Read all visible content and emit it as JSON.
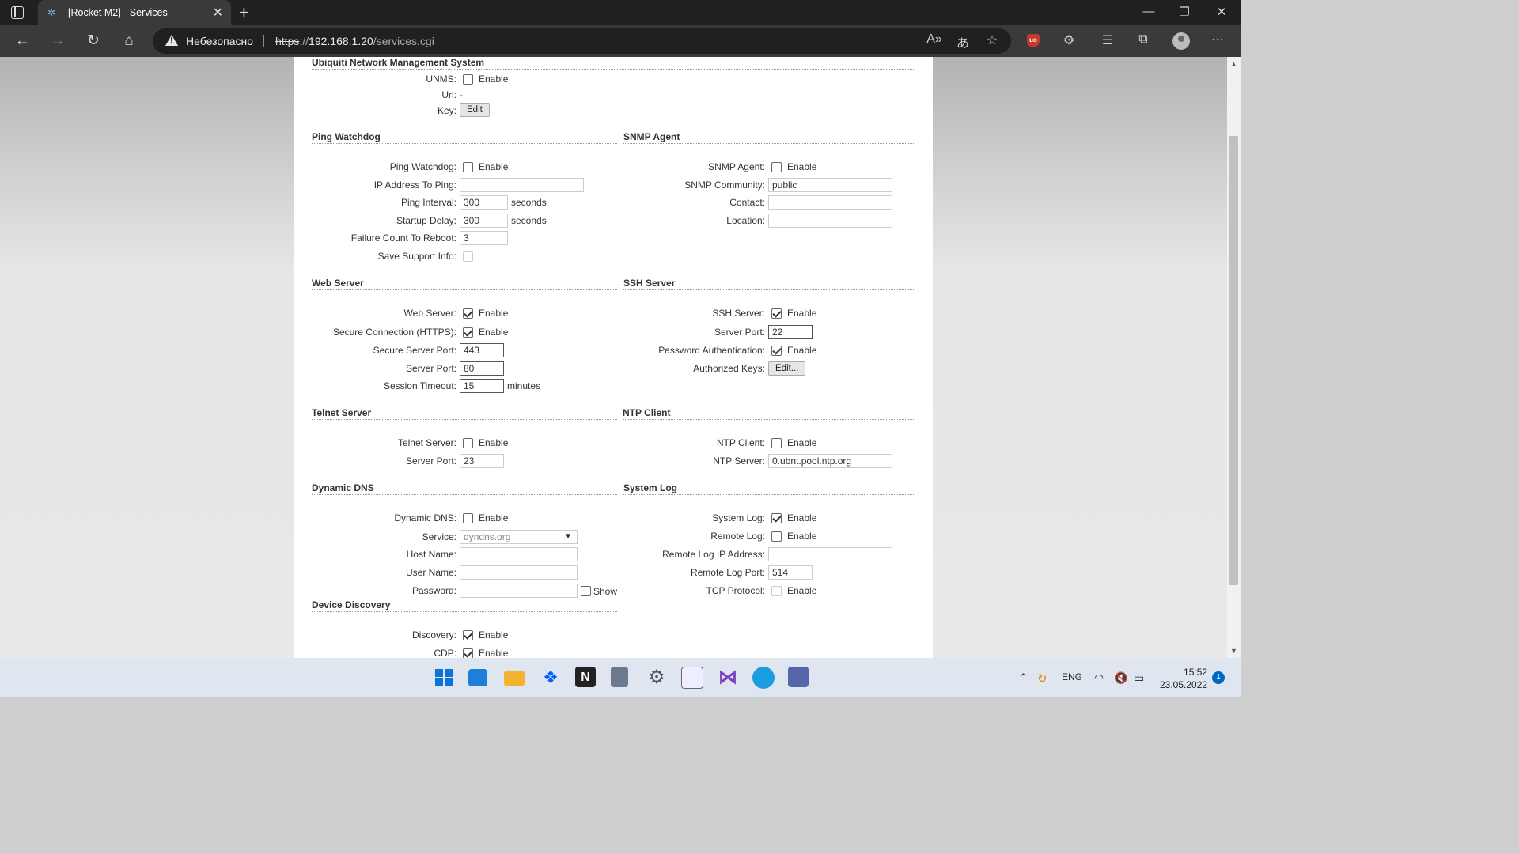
{
  "browser": {
    "tab_title": "[Rocket M2] - Services",
    "new_tab": "+",
    "insecure_label": "Небезопасно",
    "url_scheme": "https",
    "url_sep": "://",
    "url_host": "192.168.1.20",
    "url_path": "/services.cgi"
  },
  "unms": {
    "section": "Ubiquiti Network Management System",
    "unms_label": "UNMS:",
    "enable": "Enable",
    "url_label": "Url:",
    "url_value": "-",
    "key_label": "Key:",
    "edit_button": "Edit"
  },
  "ping": {
    "section": "Ping Watchdog",
    "watchdog_label": "Ping Watchdog:",
    "enable": "Enable",
    "ip_label": "IP Address To Ping:",
    "ip_value": "",
    "interval_label": "Ping Interval:",
    "interval_value": "300",
    "interval_unit": "seconds",
    "startup_label": "Startup Delay:",
    "startup_value": "300",
    "startup_unit": "seconds",
    "failure_label": "Failure Count To Reboot:",
    "failure_value": "3",
    "support_label": "Save Support Info:"
  },
  "snmp": {
    "section": "SNMP Agent",
    "agent_label": "SNMP Agent:",
    "enable": "Enable",
    "community_label": "SNMP Community:",
    "community_value": "public",
    "contact_label": "Contact:",
    "contact_value": "",
    "location_label": "Location:",
    "location_value": ""
  },
  "web": {
    "section": "Web Server",
    "server_label": "Web Server:",
    "enable": "Enable",
    "https_label": "Secure Connection (HTTPS):",
    "https_enable": "Enable",
    "secure_port_label": "Secure Server Port:",
    "secure_port_value": "443",
    "port_label": "Server Port:",
    "port_value": "80",
    "timeout_label": "Session Timeout:",
    "timeout_value": "15",
    "timeout_unit": "minutes"
  },
  "ssh": {
    "section": "SSH Server",
    "server_label": "SSH Server:",
    "enable": "Enable",
    "port_label": "Server Port:",
    "port_value": "22",
    "pwauth_label": "Password Authentication:",
    "pwauth_enable": "Enable",
    "keys_label": "Authorized Keys:",
    "keys_button": "Edit..."
  },
  "telnet": {
    "section": "Telnet Server",
    "server_label": "Telnet Server:",
    "enable": "Enable",
    "port_label": "Server Port:",
    "port_value": "23"
  },
  "ntp": {
    "section": "NTP Client",
    "client_label": "NTP Client:",
    "enable": "Enable",
    "server_label": "NTP Server:",
    "server_value": "0.ubnt.pool.ntp.org"
  },
  "ddns": {
    "section": "Dynamic DNS",
    "ddns_label": "Dynamic DNS:",
    "enable": "Enable",
    "service_label": "Service:",
    "service_value": "dyndns.org",
    "host_label": "Host Name:",
    "host_value": "",
    "user_label": "User Name:",
    "user_value": "",
    "password_label": "Password:",
    "password_value": "",
    "show_label": "Show"
  },
  "syslog": {
    "section": "System Log",
    "log_label": "System Log:",
    "enable": "Enable",
    "remote_label": "Remote Log:",
    "remote_enable": "Enable",
    "remote_ip_label": "Remote Log IP Address:",
    "remote_ip_value": "",
    "remote_port_label": "Remote Log Port:",
    "remote_port_value": "514",
    "tcp_label": "TCP Protocol:",
    "tcp_enable": "Enable"
  },
  "discovery": {
    "section": "Device Discovery",
    "discovery_label": "Discovery:",
    "enable": "Enable",
    "cdp_label": "CDP:",
    "cdp_enable": "Enable"
  },
  "taskbar": {
    "lang": "ENG",
    "time": "15:52",
    "date": "23.05.2022",
    "notifications": "1"
  },
  "colors": {
    "ublock": "#c0392b",
    "notif": "#0067c0"
  }
}
